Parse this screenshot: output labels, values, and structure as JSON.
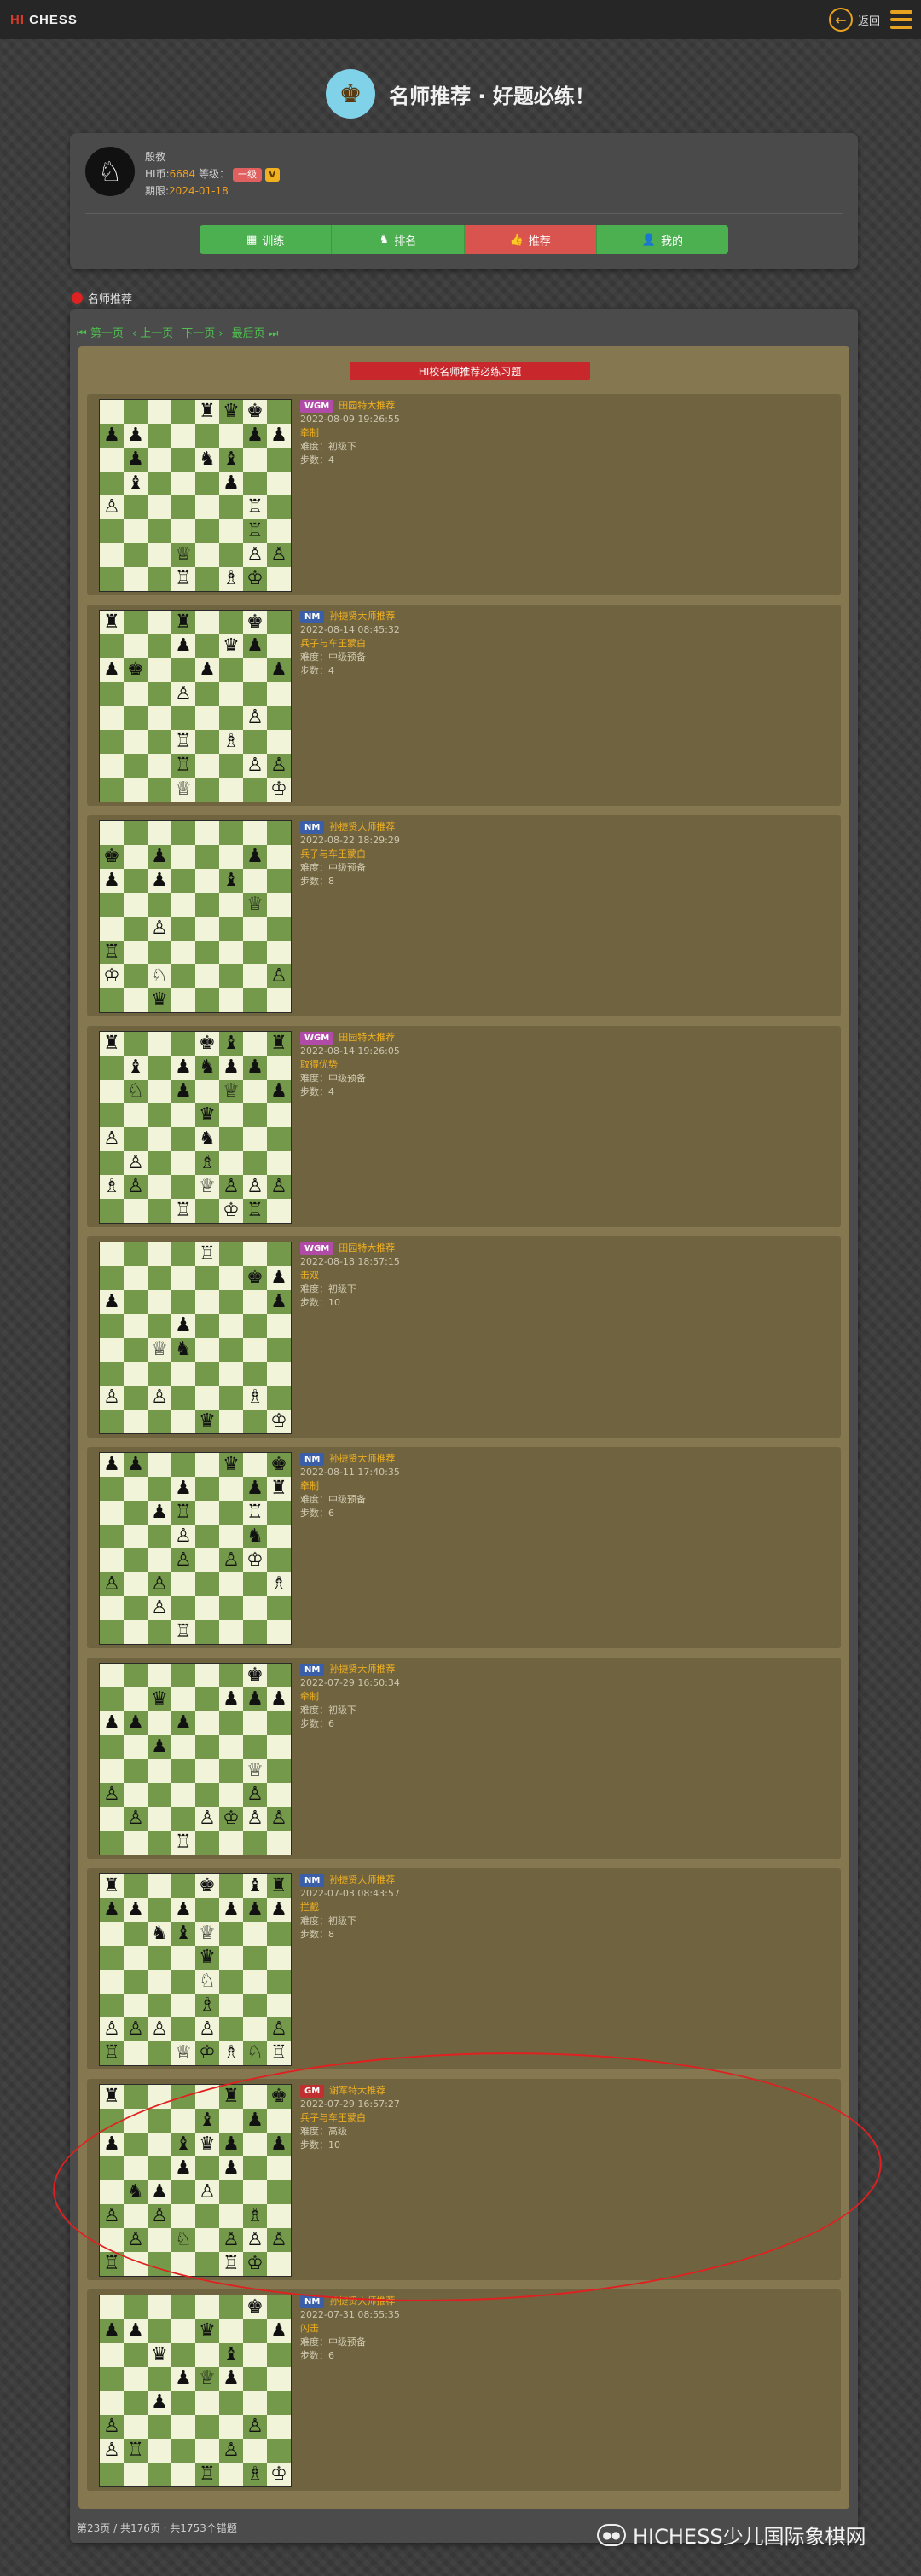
{
  "topbar": {
    "logo_hi": "HI",
    "logo_chess": "CHESS",
    "back_label": "返回"
  },
  "hero": {
    "title": "名师推荐 · 好题必练！"
  },
  "profile": {
    "username": "殷教",
    "coins_label": "HI币:",
    "coins": "6684",
    "level_label": "等级：",
    "level": "一级",
    "vip": "V",
    "expiry_label": "期限:",
    "expiry": "2024-01-18"
  },
  "nav": [
    {
      "icon": "▦",
      "label": "训练",
      "active": false
    },
    {
      "icon": "♞",
      "label": "排名",
      "active": false
    },
    {
      "icon": "👍",
      "label": "推荐",
      "active": true
    },
    {
      "icon": "👤",
      "label": "我的",
      "active": false
    }
  ],
  "section": {
    "title": "名师推荐"
  },
  "pager": {
    "first": "第一页",
    "prev": "上一页",
    "next": "下一页",
    "last": "最后页"
  },
  "banner": "HI校名师推荐必练习题",
  "colors": {
    "accent": "#e8a21f",
    "green": "#4cb050",
    "red": "#d9534f",
    "board_light": "#f1f4d8",
    "board_dark": "#74994a"
  },
  "puzzles": [
    {
      "badge": "WGM",
      "coach": "田园特大推荐",
      "date": "2022-08-09 19:26:55",
      "theme": "牵制",
      "difficulty": "难度：初级下",
      "steps": "步数：4",
      "board": [
        "....rqk.",
        "pp....pp",
        ".p..nb..",
        ".b...p..",
        "P.....R.",
        "......R.",
        "...Q..PP",
        "...R.BK."
      ]
    },
    {
      "badge": "NM",
      "coach": "孙捷贤大师推荐",
      "date": "2022-08-14 08:45:32",
      "theme": "兵子与车王蒙白",
      "difficulty": "难度：中级预备",
      "steps": "步数：4",
      "board": [
        "r..r..k.",
        "...p.qp.",
        "pk..p..p",
        "...P....",
        "......P.",
        "...R.B..",
        "...R..PP",
        "...Q...K"
      ]
    },
    {
      "badge": "NM",
      "coach": "孙捷贤大师推荐",
      "date": "2022-08-22 18:29:29",
      "theme": "兵子与车王蒙白",
      "difficulty": "难度：中级预备",
      "steps": "步数：8",
      "board": [
        "........",
        "k.p...p.",
        "p.p..b..",
        "......Q.",
        "..P.....",
        "R.......",
        "K.N....P",
        "..q....."
      ]
    },
    {
      "badge": "WGM",
      "coach": "田园特大推荐",
      "date": "2022-08-14 19:26:05",
      "theme": "取得优势",
      "difficulty": "难度：中级预备",
      "steps": "步数：4",
      "board": [
        "r...kb.r",
        ".b.pnpp.",
        ".N.p.Q.p",
        "....q...",
        "P...n...",
        ".P..B...",
        "BP..QPPP",
        "...R.KR."
      ]
    },
    {
      "badge": "WGM",
      "coach": "田园特大推荐",
      "date": "2022-08-18 18:57:15",
      "theme": "击双",
      "difficulty": "难度：初级下",
      "steps": "步数：10",
      "board": [
        "....R...",
        "......kp",
        "p......p",
        "...p....",
        "..Qn....",
        "........",
        "P.P...B.",
        "....q..K"
      ]
    },
    {
      "badge": "NM",
      "coach": "孙捷贤大师推荐",
      "date": "2022-08-11 17:40:35",
      "theme": "牵制",
      "difficulty": "难度：中级预备",
      "steps": "步数：6",
      "board": [
        "pp...q.k",
        "...p..pr",
        "..pR..R.",
        "...P..n.",
        "...P.PK.",
        "P.P....B",
        "..P.....",
        "...R...."
      ]
    },
    {
      "badge": "NM",
      "coach": "孙捷贤大师推荐",
      "date": "2022-07-29 16:50:34",
      "theme": "牵制",
      "difficulty": "难度：初级下",
      "steps": "步数：6",
      "board": [
        "......k.",
        "..q..ppp",
        "pp.p....",
        "..p.....",
        "......Q.",
        "P.....P.",
        ".P..PKPP",
        "...R...."
      ]
    },
    {
      "badge": "NM",
      "coach": "孙捷贤大师推荐",
      "date": "2022-07-03 08:43:57",
      "theme": "拦截",
      "difficulty": "难度：初级下",
      "steps": "步数：8",
      "board": [
        "r...k.br",
        "pp.p.ppp",
        "..nbQ...",
        "....q...",
        "....N...",
        "....B...",
        "PPP.P..P",
        "R..QKBNR"
      ]
    },
    {
      "badge": "GM",
      "coach": "谢军特大推荐",
      "date": "2022-07-29 16:57:27",
      "theme": "兵子与车王蒙白",
      "difficulty": "难度：高级",
      "steps": "步数：10",
      "board": [
        "r....r.k",
        "....b.p.",
        "p..bqp.p",
        "...p.p..",
        ".np.P...",
        "P.P...B.",
        ".P.N.PPP",
        "R....RK."
      ]
    },
    {
      "badge": "NM",
      "coach": "孙捷贤大师推荐",
      "date": "2022-07-31 08:55:35",
      "theme": "闪击",
      "difficulty": "难度：中级预备",
      "steps": "步数：6",
      "board": [
        "......k.",
        "pp..q..p",
        "..q..b..",
        "...pQp..",
        "..p.....",
        "P.....P.",
        "PR...P..",
        "....R.BK"
      ]
    }
  ],
  "footer": "第23页 / 共176页 · 共1753个错题",
  "watermark": "HICHESS少儿国际象棋网"
}
